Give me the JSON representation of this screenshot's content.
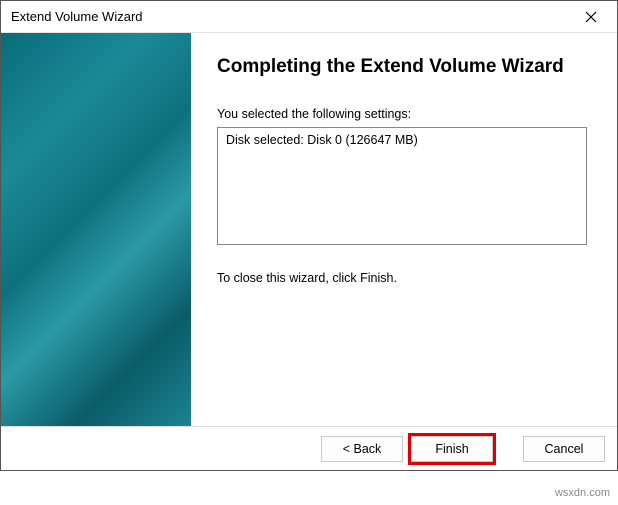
{
  "window": {
    "title": "Extend Volume Wizard"
  },
  "main": {
    "heading": "Completing the Extend Volume Wizard",
    "settings_label": "You selected the following settings:",
    "summary": "Disk selected: Disk 0 (126647 MB)",
    "hint": "To close this wizard, click Finish."
  },
  "buttons": {
    "back": "< Back",
    "finish": "Finish",
    "cancel": "Cancel"
  },
  "watermark": "wsxdn.com"
}
